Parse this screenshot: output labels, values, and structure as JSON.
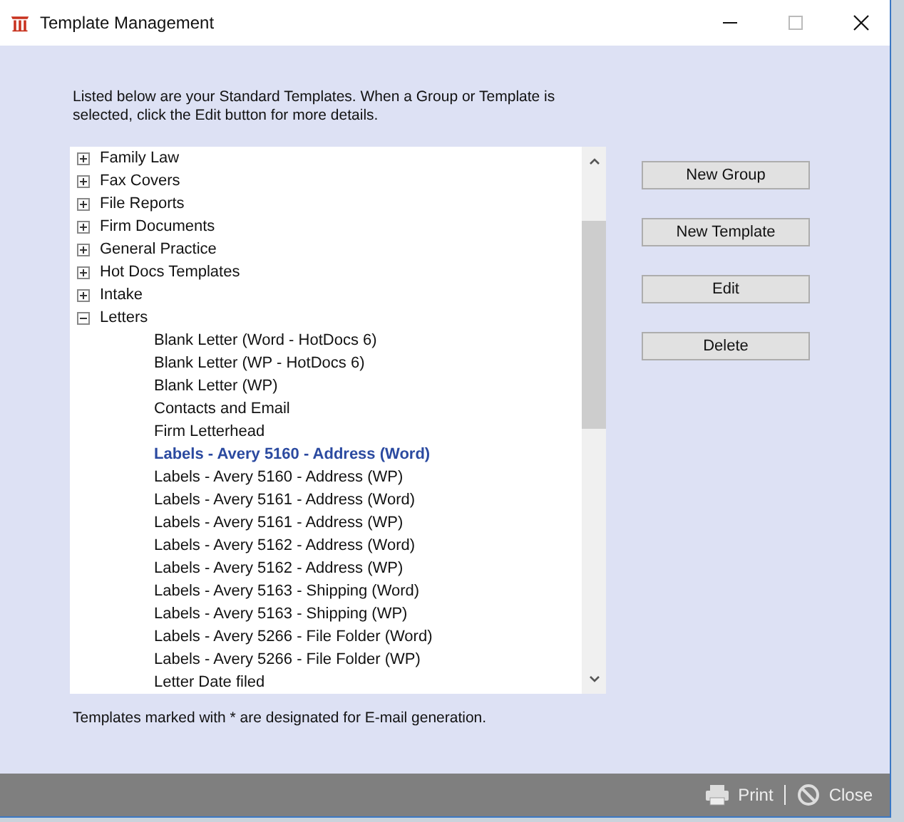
{
  "window": {
    "title": "Template Management"
  },
  "intro": "Listed below are your Standard Templates. When a Group or Template is selected, click the Edit button for more details.",
  "tree": [
    {
      "label": "Family Law",
      "expanded": false,
      "selected": false
    },
    {
      "label": "Fax Covers",
      "expanded": false,
      "selected": false
    },
    {
      "label": "File Reports",
      "expanded": false,
      "selected": false
    },
    {
      "label": "Firm Documents",
      "expanded": false,
      "selected": false
    },
    {
      "label": "General Practice",
      "expanded": false,
      "selected": false
    },
    {
      "label": "Hot Docs Templates",
      "expanded": false,
      "selected": false
    },
    {
      "label": "Intake",
      "expanded": false,
      "selected": false
    },
    {
      "label": "Letters",
      "expanded": true,
      "selected": false,
      "children": [
        {
          "label": "Blank Letter (Word - HotDocs 6)",
          "selected": false
        },
        {
          "label": "Blank Letter (WP - HotDocs 6)",
          "selected": false
        },
        {
          "label": "Blank Letter (WP)",
          "selected": false
        },
        {
          "label": "Contacts and Email",
          "selected": false
        },
        {
          "label": "Firm Letterhead",
          "selected": false
        },
        {
          "label": "Labels - Avery 5160 - Address  (Word)",
          "selected": true
        },
        {
          "label": "Labels - Avery 5160 - Address (WP)",
          "selected": false
        },
        {
          "label": "Labels - Avery 5161 - Address (Word)",
          "selected": false
        },
        {
          "label": "Labels - Avery 5161 - Address (WP)",
          "selected": false
        },
        {
          "label": "Labels - Avery 5162 - Address (Word)",
          "selected": false
        },
        {
          "label": "Labels - Avery 5162 - Address (WP)",
          "selected": false
        },
        {
          "label": "Labels - Avery 5163 - Shipping (Word)",
          "selected": false
        },
        {
          "label": "Labels - Avery 5163 - Shipping (WP)",
          "selected": false
        },
        {
          "label": "Labels - Avery 5266 - File Folder (Word)",
          "selected": false
        },
        {
          "label": "Labels - Avery 5266 - File Folder (WP)",
          "selected": false
        },
        {
          "label": "Letter Date filed",
          "selected": false
        }
      ]
    }
  ],
  "buttons": [
    "New Group",
    "New Template",
    "Edit",
    "Delete"
  ],
  "note": "Templates marked with * are designated for E-mail generation.",
  "footer": {
    "print": "Print",
    "close": "Close"
  }
}
